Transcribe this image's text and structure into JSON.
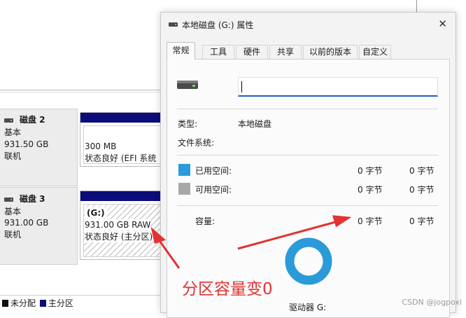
{
  "disk_management": {
    "disks": [
      {
        "name": "磁盘 2",
        "type": "基本",
        "size": "931.50 GB",
        "status": "联机",
        "partition": {
          "label": "",
          "size": "300 MB",
          "state": "状态良好 (EFI 系统"
        }
      },
      {
        "name": "磁盘 3",
        "type": "基本",
        "size": "931.00 GB",
        "status": "联机",
        "partition": {
          "label": "(G:)",
          "size": "931.00 GB RAW",
          "state": "状态良好 (主分区)"
        }
      }
    ],
    "legend": [
      {
        "label": "未分配",
        "color": "#111111"
      },
      {
        "label": "主分区",
        "color": "#0c0c7a"
      }
    ]
  },
  "dialog": {
    "title": "本地磁盘 (G:) 属性",
    "close_glyph": "✕",
    "tabs": [
      "常规",
      "工具",
      "硬件",
      "共享",
      "以前的版本",
      "自定义"
    ],
    "active_tab": "常规",
    "general": {
      "volume_name": "",
      "type_label": "类型:",
      "type_value": "本地磁盘",
      "fs_label": "文件系统:",
      "fs_value": "",
      "used_label": "已用空间:",
      "used_bytes": "0 字节",
      "used_size": "0 字节",
      "used_color": "#2a9bd8",
      "free_label": "可用空间:",
      "free_bytes": "0 字节",
      "free_size": "0 字节",
      "free_color": "#a8a8a8",
      "capacity_label": "容量:",
      "capacity_bytes": "0 字节",
      "capacity_size": "0 字节",
      "drive_label": "驱动器 G:",
      "ring_color": "#2a9bd8"
    }
  },
  "annotation": {
    "text": "分区容量变0",
    "color": "#e23232"
  },
  "watermark": "CSDN @jogpoxi"
}
